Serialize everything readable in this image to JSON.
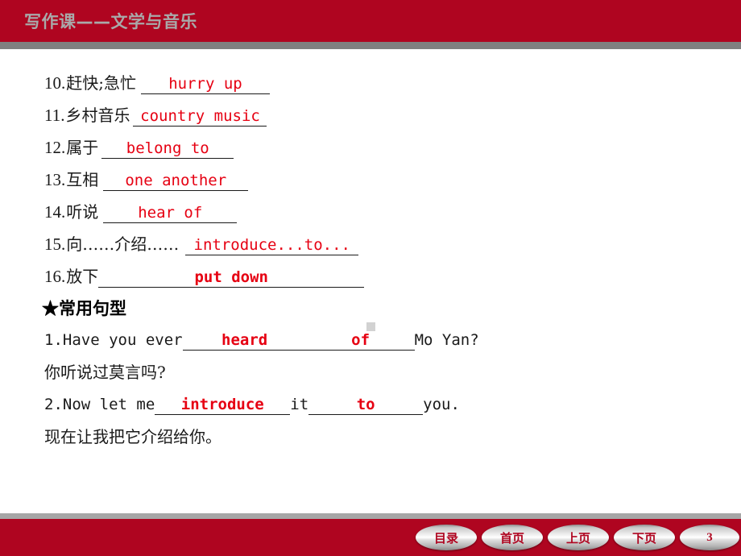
{
  "header": {
    "title": "写作课——文学与音乐",
    "band_color": "#af0520",
    "title_color": "#a9a9a9"
  },
  "answer_color": "#e60012",
  "vocabulary": [
    {
      "num": "10.",
      "cn": "赶快;急忙",
      "answer": "hurry up",
      "blank_width": 160
    },
    {
      "num": "11.",
      "cn": "乡村音乐",
      "answer": "country music",
      "blank_width": 166
    },
    {
      "num": "12.",
      "cn": "属于",
      "answer": "belong to",
      "blank_width": 164
    },
    {
      "num": "13.",
      "cn": "互相",
      "answer": "one another",
      "blank_width": 180
    },
    {
      "num": "14.",
      "cn": "听说",
      "answer": "hear of",
      "blank_width": 166
    },
    {
      "num": "15.",
      "cn": "向……介绍……",
      "answer": "introduce...to...",
      "blank_width": 215
    },
    {
      "num": "16.",
      "cn": "放下",
      "answer": "put down",
      "blank_width": 330
    }
  ],
  "patterns_heading": "★常用句型",
  "sentences": [
    {
      "num": "1.",
      "pre": "Have you ever",
      "blank1": "heard",
      "blank1_width": 154,
      "gap": " ",
      "blank2": "of",
      "blank2_width": 134,
      "post": "Mo Yan?",
      "translation": "你听说过莫言吗?"
    },
    {
      "num": "2.",
      "pre": "Now let me",
      "blank1": "introduce",
      "blank1_width": 168,
      "gap": "it",
      "blank2": "to",
      "blank2_width": 142,
      "post": "you.",
      "translation": "现在让我把它介绍给你。"
    }
  ],
  "footer": {
    "buttons": [
      {
        "label": "目录",
        "name": "contents"
      },
      {
        "label": "首页",
        "name": "home"
      },
      {
        "label": "上页",
        "name": "previous"
      },
      {
        "label": "下页",
        "name": "next"
      }
    ],
    "page_number": "3",
    "band_color": "#af0520"
  }
}
